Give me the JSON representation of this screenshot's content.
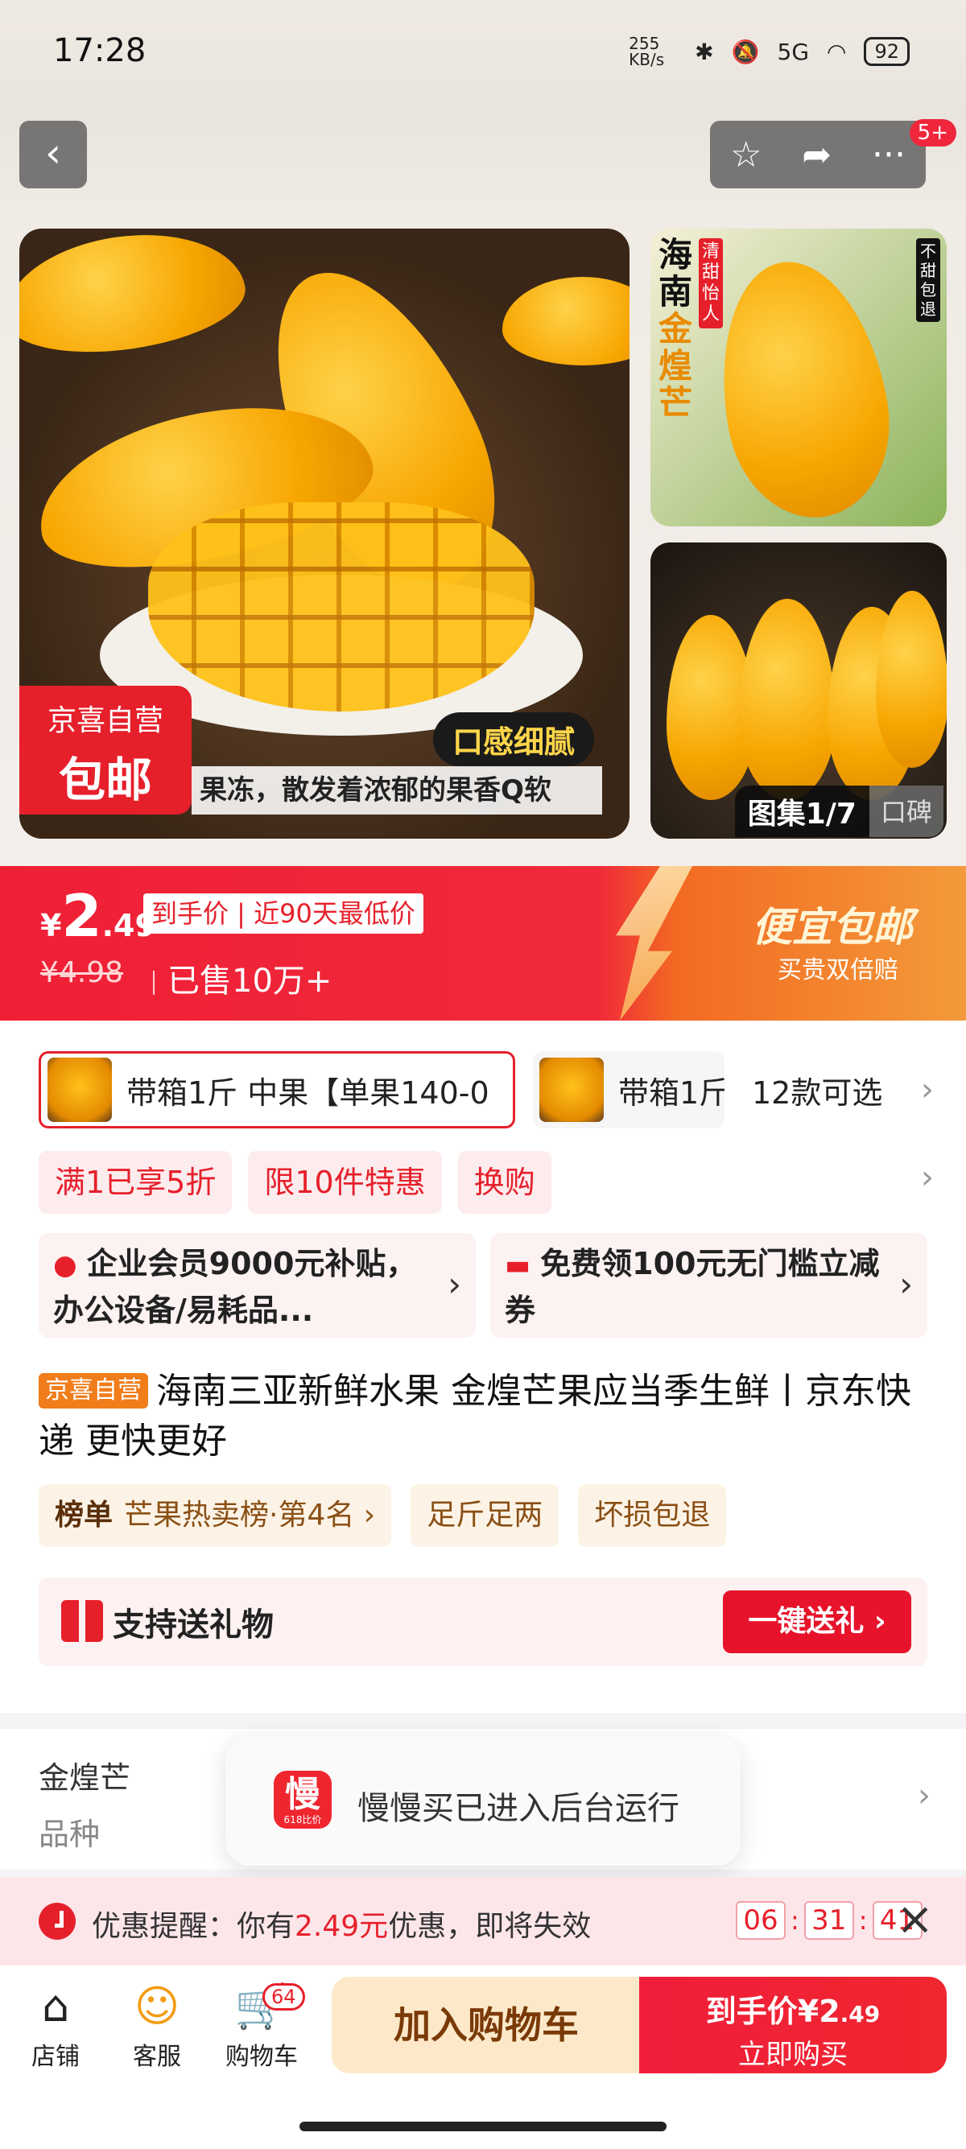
{
  "status_bar": {
    "time": "17:28",
    "speed": "255 KB/s",
    "network": "5G",
    "battery": "92"
  },
  "header": {
    "back": "‹",
    "favorite": "☆",
    "share": "➦",
    "more": "···",
    "more_badge": "5+"
  },
  "gallery": {
    "badge_line1": "京喜自营",
    "badge_line2": "包邮",
    "taste_tag": "口感细腻",
    "caption": "果冻，散发着浓郁的果香Q软",
    "thumb1_title": [
      "海",
      "南",
      "金",
      "煌",
      "芒"
    ],
    "thumb1_red": "清甜怡人",
    "thumb1_black": "不甜包退",
    "counter": "图集1/7",
    "reviews": "口碑"
  },
  "price": {
    "currency": "¥",
    "integer": "2",
    "decimal": ".49",
    "tag": "到手价 | 近90天最低价",
    "original": "¥4.98",
    "sold": "已售10万+",
    "shipping_main": "便宜包邮",
    "shipping_sub": "买贵双倍赔"
  },
  "sku": {
    "selected": "带箱1斤 中果【单果140-0",
    "other": "带箱1斤",
    "more": "12款可选"
  },
  "promos": [
    "满1已享5折",
    "限10件特惠",
    "换购"
  ],
  "cards": [
    {
      "icon": "person-icon",
      "text": "企业会员9000元补贴，办公设备/易耗品..."
    },
    {
      "icon": "coupon-icon",
      "text": "免费领100元无门槛立减券"
    }
  ],
  "title": {
    "badge": "京喜自营",
    "text": "海南三亚新鲜水果 金煌芒果应当季生鲜丨京东快递 更快更好"
  },
  "tags": [
    {
      "bold": "榜单",
      "text": "芒果热卖榜·第4名 ›"
    },
    {
      "bold": "",
      "text": "足斤足两"
    },
    {
      "bold": "",
      "text": "坏损包退"
    }
  ],
  "gift": {
    "label": "支持送礼物",
    "button": "一键送礼 ›"
  },
  "variety": {
    "key": "金煌芒",
    "label": "品种"
  },
  "toast": {
    "app": "慢",
    "app_sub": "618比价",
    "message": "慢慢买已进入后台运行"
  },
  "reminder": {
    "prefix": "优惠提醒：你有",
    "amount": "2.49元",
    "suffix": "优惠，即将失效",
    "hh": "06",
    "mm": "31",
    "ss": "41"
  },
  "bottom_nav": {
    "shop": "店铺",
    "service": "客服",
    "cart": "购物车",
    "cart_count": "64",
    "add_cart": "加入购物车",
    "buy_line1": "到手价¥2",
    "buy_line1_dec": ".49",
    "buy_line2": "立即购买"
  },
  "colors": {
    "accent": "#e6202b",
    "orange": "#f07c1a",
    "cart_bg": "#fde9c9"
  }
}
